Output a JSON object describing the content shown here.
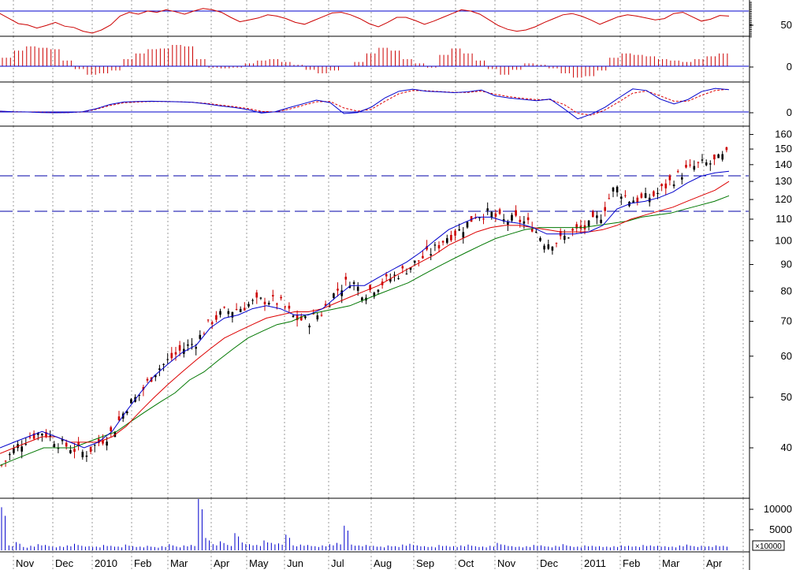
{
  "colors": {
    "background": "#ffffff",
    "frame": "#000000",
    "grid": "#9a9a9a",
    "reference_line": "#0000cc",
    "rsi": "#cc0000",
    "histogram": "#cc0000",
    "macd": "#0000cc",
    "macd_signal": "#dd0000",
    "price_up": "#000000",
    "price_down": "#cc0000",
    "ma_fast": "#0000cc",
    "ma_mid": "#dd0000",
    "ma_slow": "#007700",
    "resistance": "#0000aa",
    "volume": "#0000cc"
  },
  "chart_data": [
    {
      "type": "line",
      "panel": "rsi",
      "ylabels": [
        "50"
      ],
      "reference_levels": [
        70,
        30
      ],
      "grid": true,
      "series": [
        {
          "values": [
            66,
            58,
            50,
            48,
            43,
            47,
            52,
            46,
            44,
            38,
            35,
            40,
            48,
            62,
            68,
            65,
            70,
            68,
            72,
            69,
            65,
            70,
            74,
            72,
            68,
            60,
            53,
            56,
            59,
            64,
            62,
            58,
            52,
            49,
            55,
            61,
            67,
            68,
            64,
            58,
            50,
            45,
            52,
            60,
            60,
            55,
            49,
            54,
            60,
            66,
            72,
            70,
            65,
            56,
            47,
            41,
            38,
            40,
            45,
            52,
            58,
            64,
            66,
            62,
            56,
            49,
            55,
            61,
            64,
            62,
            59,
            56,
            58,
            66,
            68,
            61,
            54,
            57,
            63,
            62
          ]
        }
      ]
    },
    {
      "type": "bar",
      "panel": "momentum-histogram",
      "ylabels": [
        "0"
      ],
      "grid": true,
      "series": [
        {
          "values": [
            12,
            22,
            28,
            26,
            24,
            8,
            -4,
            -12,
            -10,
            -6,
            10,
            18,
            24,
            25,
            30,
            28,
            10,
            -2,
            -3,
            -2,
            4,
            8,
            10,
            6,
            2,
            -5,
            -10,
            -6,
            0,
            6,
            18,
            26,
            22,
            10,
            4,
            -2,
            16,
            25,
            18,
            8,
            -4,
            -12,
            -5,
            4,
            2,
            -3,
            -10,
            -16,
            -14,
            -6,
            12,
            18,
            16,
            14,
            10,
            8,
            6,
            10,
            14,
            18
          ]
        }
      ]
    },
    {
      "type": "line",
      "panel": "macd",
      "ylabels": [
        "0"
      ],
      "grid": true,
      "series": [
        {
          "values": [
            0.3,
            0.1,
            0,
            -0.2,
            -0.3,
            -0.2,
            0.1,
            1.2,
            2.8,
            3.7,
            3.9,
            4.0,
            3.9,
            3.8,
            3.6,
            3.0,
            2.3,
            1.7,
            0.9,
            -0.4,
            0.1,
            1.6,
            3.0,
            4.4,
            3.5,
            -0.6,
            -0.2,
            1.8,
            5.3,
            7.7,
            8.5,
            7.7,
            7.5,
            7.2,
            7.5,
            8.2,
            6.0,
            5.2,
            4.7,
            4.2,
            4.8,
            1.2,
            -2.6,
            -0.8,
            1.8,
            5.3,
            8.6,
            8.0,
            4.8,
            3.0,
            4.6,
            7.6,
            8.8,
            8.3
          ]
        },
        {
          "values": [
            0.2,
            0.1,
            0,
            -0.1,
            -0.2,
            -0.2,
            0,
            1.0,
            2.4,
            3.4,
            3.7,
            3.9,
            3.9,
            3.8,
            3.6,
            3.2,
            2.6,
            2.0,
            1.3,
            0.2,
            0,
            1.0,
            2.4,
            3.8,
            3.9,
            1.5,
            0.3,
            1.0,
            4.0,
            6.8,
            8.0,
            7.9,
            7.6,
            7.3,
            7.3,
            7.8,
            6.6,
            5.7,
            5.1,
            4.6,
            4.6,
            2.8,
            -0.5,
            -1.2,
            0.8,
            3.8,
            7.0,
            7.8,
            6.0,
            4.0,
            4.0,
            6.2,
            8.0,
            8.5
          ]
        }
      ]
    },
    {
      "type": "line",
      "panel": "price",
      "log_scale": true,
      "yticks": [
        "160",
        "150",
        "140",
        "130",
        "120",
        "110",
        "100",
        "90",
        "80",
        "70",
        "60",
        "50",
        "40"
      ],
      "resistance_levels": [
        136,
        115
      ],
      "grid": true,
      "series": [
        {
          "values": [
            37,
            40,
            42,
            43,
            41,
            40,
            39,
            41,
            43,
            48,
            51,
            56,
            59,
            62,
            64,
            70,
            73,
            74,
            76,
            77,
            76,
            71,
            70,
            73,
            80,
            84,
            79,
            82,
            85,
            88,
            92,
            96,
            102,
            105,
            112,
            113,
            109,
            110,
            107,
            99,
            100,
            104,
            106,
            112,
            127,
            120,
            120,
            123,
            130,
            136,
            140,
            141,
            146
          ]
        },
        {
          "values": [
            40,
            41,
            42,
            43,
            42,
            41,
            40,
            41,
            43,
            47,
            51,
            55,
            58,
            61,
            63,
            68,
            71,
            72,
            74,
            75,
            74,
            72,
            72,
            74,
            78,
            82,
            82,
            85,
            88,
            91,
            95,
            100,
            105,
            108,
            111,
            111,
            109,
            108,
            106,
            103,
            103,
            103,
            104,
            107,
            115,
            118,
            119,
            121,
            124,
            129,
            133,
            135,
            136
          ]
        },
        {
          "values": [
            39,
            40,
            41,
            42,
            42,
            41,
            41,
            41,
            42,
            44,
            47,
            50,
            53,
            56,
            59,
            62,
            65,
            67,
            69,
            71,
            72,
            73,
            73,
            74,
            76,
            78,
            80,
            82,
            85,
            88,
            91,
            94,
            98,
            101,
            104,
            106,
            107,
            107,
            106,
            105,
            104,
            104,
            104,
            105,
            107,
            110,
            112,
            114,
            116,
            119,
            122,
            125,
            130
          ]
        },
        {
          "values": [
            37,
            38,
            39,
            40,
            40,
            40,
            41,
            42,
            43,
            45,
            47,
            49,
            51,
            54,
            56,
            59,
            62,
            65,
            67,
            69,
            70,
            72,
            73,
            74,
            75,
            77,
            79,
            81,
            83,
            86,
            89,
            92,
            95,
            98,
            101,
            103,
            105,
            106,
            106,
            106,
            106,
            107,
            108,
            109,
            111,
            112,
            113,
            115,
            117,
            119,
            122
          ]
        }
      ]
    },
    {
      "type": "bar",
      "panel": "volume",
      "yticks": [
        "10000",
        "5000"
      ],
      "unit_label": "×10000",
      "grid": true,
      "series": [
        {
          "values": [
            10500,
            1200,
            2000,
            800,
            1100,
            1500,
            1300,
            900,
            1000,
            1200,
            1600,
            1100,
            1000,
            900,
            1300,
            1100,
            900,
            1400,
            1000,
            900,
            1100,
            800,
            1000,
            1500,
            900,
            1200,
            1300,
            12500,
            3000,
            1500,
            2200,
            1300,
            4200,
            1900,
            1500,
            1300,
            2400,
            1800,
            1700,
            3800,
            1200,
            1400,
            1300,
            1000,
            1200,
            1500,
            1800,
            6000,
            1400,
            1200,
            1300,
            1100,
            900,
            1200,
            1000,
            1400,
            1600,
            1200,
            1000,
            900,
            1300,
            1100,
            1000,
            1200,
            1400,
            1000,
            900,
            1100,
            1800,
            1300,
            1000,
            900,
            1000,
            1300,
            1200,
            900,
            1100,
            1500,
            1000,
            900,
            1200,
            1100,
            1000,
            900,
            1000,
            1200,
            1100,
            1000,
            1300,
            1200,
            1100,
            1000,
            900,
            1200,
            1400,
            1000,
            1100,
            1000,
            1200,
            1100
          ]
        }
      ]
    }
  ],
  "x_axis": {
    "month_labels": [
      "Nov",
      "Dec",
      "2010",
      "Feb",
      "Mar",
      "Apr",
      "May",
      "Jun",
      "Jul",
      "Aug",
      "Sep",
      "Oct",
      "Nov",
      "Dec",
      "2011",
      "Feb",
      "Mar",
      "Apr"
    ]
  }
}
